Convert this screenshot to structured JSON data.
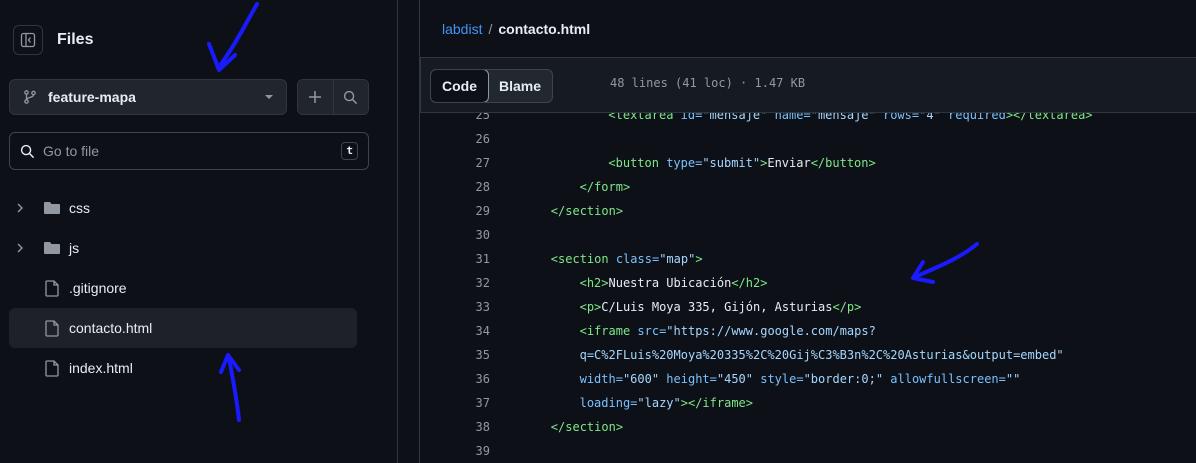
{
  "sidebar": {
    "title": "Files",
    "branch": "feature-mapa",
    "search_placeholder": "Go to file",
    "search_shortcut": "t",
    "tree": [
      {
        "name": "css",
        "type": "folder"
      },
      {
        "name": "js",
        "type": "folder"
      },
      {
        "name": ".gitignore",
        "type": "file"
      },
      {
        "name": "contacto.html",
        "type": "file",
        "active": true
      },
      {
        "name": "index.html",
        "type": "file"
      }
    ]
  },
  "breadcrumb": {
    "repo": "labdist",
    "separator": "/",
    "file": "contacto.html"
  },
  "file_header": {
    "code_tab": "Code",
    "blame_tab": "Blame",
    "meta": "48 lines (41 loc) · 1.47 KB"
  },
  "code": {
    "lines": [
      {
        "n": "25",
        "indent": 12,
        "tokens": [
          [
            "t",
            "<textarea "
          ],
          [
            "a",
            "id="
          ],
          [
            "s",
            "\"mensaje\""
          ],
          [
            "a",
            " name="
          ],
          [
            "s",
            "\"mensaje\""
          ],
          [
            "a",
            " rows="
          ],
          [
            "s",
            "\"4\""
          ],
          [
            "a",
            " required"
          ],
          [
            "t",
            "></textarea>"
          ]
        ]
      },
      {
        "n": "26",
        "indent": 0,
        "tokens": []
      },
      {
        "n": "27",
        "indent": 12,
        "tokens": [
          [
            "t",
            "<button "
          ],
          [
            "a",
            "type="
          ],
          [
            "s",
            "\"submit\""
          ],
          [
            "t",
            ">"
          ],
          [
            "p",
            "Enviar"
          ],
          [
            "t",
            "</button>"
          ]
        ]
      },
      {
        "n": "28",
        "indent": 8,
        "tokens": [
          [
            "t",
            "</form>"
          ]
        ]
      },
      {
        "n": "29",
        "indent": 4,
        "tokens": [
          [
            "t",
            "</section>"
          ]
        ]
      },
      {
        "n": "30",
        "indent": 0,
        "tokens": []
      },
      {
        "n": "31",
        "indent": 4,
        "tokens": [
          [
            "t",
            "<section "
          ],
          [
            "a",
            "class="
          ],
          [
            "s",
            "\"map\""
          ],
          [
            "t",
            ">"
          ]
        ]
      },
      {
        "n": "32",
        "indent": 8,
        "tokens": [
          [
            "t",
            "<h2>"
          ],
          [
            "p",
            "Nuestra Ubicación"
          ],
          [
            "t",
            "</h2>"
          ]
        ]
      },
      {
        "n": "33",
        "indent": 8,
        "tokens": [
          [
            "t",
            "<p>"
          ],
          [
            "p",
            "C/Luis Moya 335, Gijón, Asturias"
          ],
          [
            "t",
            "</p>"
          ]
        ]
      },
      {
        "n": "34",
        "indent": 8,
        "tokens": [
          [
            "t",
            "<iframe "
          ],
          [
            "a",
            "src="
          ],
          [
            "s",
            "\"https://www.google.com/maps?"
          ]
        ]
      },
      {
        "n": "35",
        "indent": 8,
        "tokens": [
          [
            "s",
            "q=C%2FLuis%20Moya%20335%2C%20Gij%C3%B3n%2C%20Asturias&output=embed\""
          ]
        ]
      },
      {
        "n": "36",
        "indent": 8,
        "tokens": [
          [
            "a",
            "width="
          ],
          [
            "s",
            "\"600\""
          ],
          [
            "a",
            " height="
          ],
          [
            "s",
            "\"450\""
          ],
          [
            "a",
            " style="
          ],
          [
            "s",
            "\"border:0;\""
          ],
          [
            "a",
            " allowfullscreen="
          ],
          [
            "s",
            "\"\""
          ]
        ]
      },
      {
        "n": "37",
        "indent": 8,
        "tokens": [
          [
            "a",
            "loading="
          ],
          [
            "s",
            "\"lazy\""
          ],
          [
            "t",
            "></iframe>"
          ]
        ]
      },
      {
        "n": "38",
        "indent": 4,
        "tokens": [
          [
            "t",
            "</section>"
          ]
        ]
      },
      {
        "n": "39",
        "indent": 0,
        "tokens": []
      }
    ]
  },
  "colors": {
    "accent": "#4493f8",
    "annotation_arrow": "#1a1aff"
  }
}
